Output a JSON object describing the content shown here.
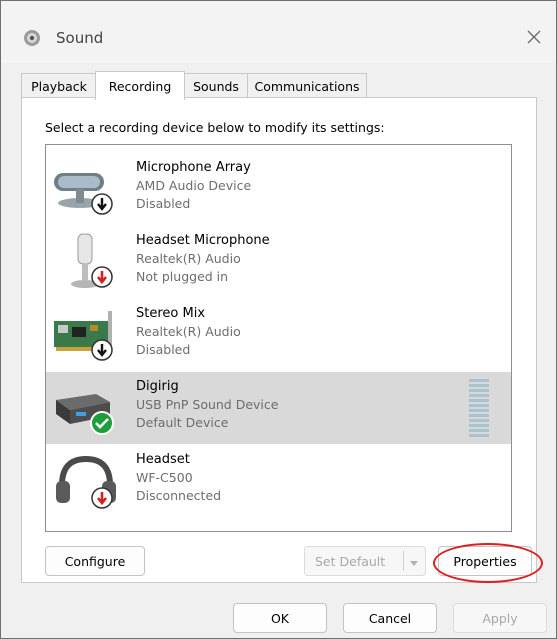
{
  "window": {
    "title": "Sound"
  },
  "tabs": [
    {
      "label": "Playback"
    },
    {
      "label": "Recording"
    },
    {
      "label": "Sounds"
    },
    {
      "label": "Communications"
    }
  ],
  "active_tab": "Recording",
  "instructions": "Select a recording device below to modify its settings:",
  "devices": [
    {
      "name": "Microphone Array",
      "driver": "AMD Audio Device",
      "status": "Disabled",
      "icon": "microphone-array-icon",
      "badge": "disabled-down-arrow-badge"
    },
    {
      "name": "Headset Microphone",
      "driver": "Realtek(R) Audio",
      "status": "Not plugged in",
      "icon": "headset-microphone-icon",
      "badge": "unplugged-red-down-arrow-badge"
    },
    {
      "name": "Stereo Mix",
      "driver": "Realtek(R) Audio",
      "status": "Disabled",
      "icon": "sound-card-icon",
      "badge": "disabled-down-arrow-badge"
    },
    {
      "name": "Digirig",
      "driver": "USB PnP Sound Device",
      "status": "Default Device",
      "icon": "usb-audio-device-icon",
      "badge": "default-green-check-badge",
      "selected": true
    },
    {
      "name": "Headset",
      "driver": "WF-C500",
      "status": "Disconnected",
      "icon": "headset-icon",
      "badge": "disconnected-red-down-arrow-badge"
    }
  ],
  "buttons": {
    "configure": "Configure",
    "set_default": "Set Default",
    "properties": "Properties",
    "ok": "OK",
    "cancel": "Cancel",
    "apply": "Apply"
  },
  "colors": {
    "selection": "#d9d9d9",
    "highlight_annotation": "#e01c1c",
    "default_badge": "#1e9e3a",
    "red_badge": "#d42020"
  }
}
